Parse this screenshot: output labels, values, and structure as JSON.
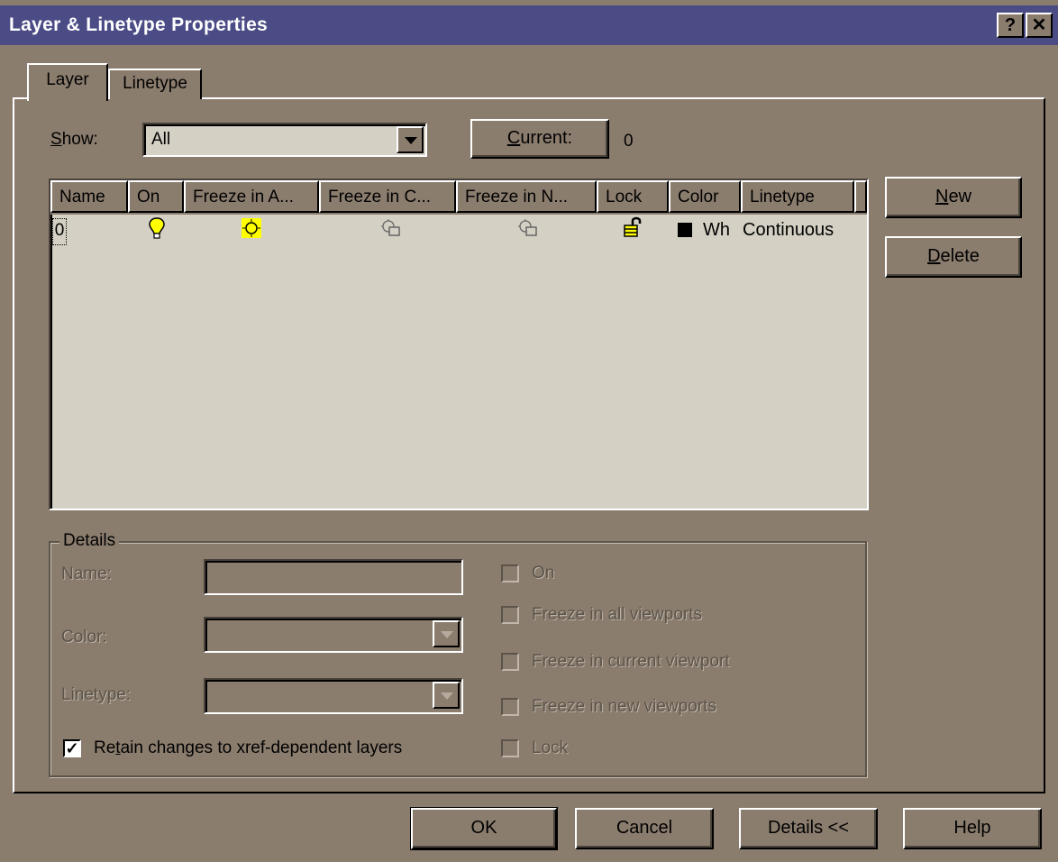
{
  "window": {
    "title": "Layer & Linetype Properties",
    "help_btn": "?",
    "close_btn": "✕"
  },
  "tabs": [
    {
      "label": "Layer",
      "active": true
    },
    {
      "label": "Linetype",
      "active": false
    }
  ],
  "filter": {
    "show_label_u": "S",
    "show_label_rest": "how:",
    "show_value": "All",
    "current_btn_u": "C",
    "current_btn_rest": "urrent:",
    "current_value": "0"
  },
  "layer_list": {
    "columns": [
      "Name",
      "On",
      "Freeze in A...",
      "Freeze in C...",
      "Freeze in N...",
      "Lock",
      "Color",
      "Linetype"
    ],
    "rows": [
      {
        "name": "0",
        "color_name": "Wh",
        "linetype": "Continuous",
        "color_swatch": "#000000"
      }
    ]
  },
  "side_buttons": {
    "new_u": "N",
    "new_rest": "ew",
    "delete_u": "D",
    "delete_rest": "elete"
  },
  "details": {
    "group_label": "Details",
    "name_label": "Name:",
    "color_label": "Color:",
    "linetype_label": "Linetype:",
    "retain_u": "t",
    "retain_pre": "Re",
    "retain_post": "ain changes to xref-dependent layers",
    "retain_checked": true,
    "on_label": "On",
    "freeze_all_label": "Freeze in all viewports",
    "freeze_current_label": "Freeze in current viewport",
    "freeze_new_label": "Freeze in new viewports",
    "lock_label": "Lock"
  },
  "footer": {
    "ok": "OK",
    "cancel": "Cancel",
    "details": "Details <<",
    "help": "Help"
  },
  "colors": {
    "dialog_bg": "#8b7d6e",
    "titlebar": "#4b4c86",
    "list_bg": "#d4d0c4",
    "icon_yellow": "#ffff00"
  }
}
